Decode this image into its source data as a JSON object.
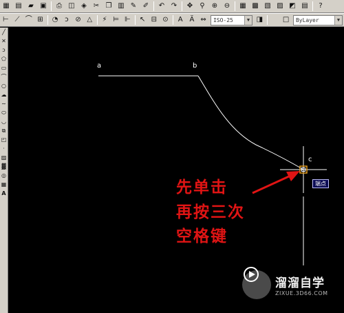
{
  "toolbar_top": {
    "icons": [
      "grid-icon",
      "new-file-icon",
      "open-folder-icon",
      "save-icon",
      "print-icon",
      "print-preview-icon",
      "publish-icon",
      "cut-icon",
      "copy-icon",
      "paste-icon",
      "match-properties-icon",
      "brush-icon",
      "undo-icon",
      "redo-icon",
      "pan-icon",
      "zoom-realtime-icon",
      "zoom-window-icon",
      "zoom-previous-icon",
      "properties-icon",
      "design-center-icon",
      "tool-palettes-icon",
      "sheet-set-icon",
      "markup-icon",
      "calculator-icon",
      "help-icon"
    ],
    "layer_combo_value": "ByLayer"
  },
  "toolbar_dim": {
    "icons": [
      "linear-dim-icon",
      "aligned-dim-icon",
      "arc-length-icon",
      "ordinate-dim-icon",
      "radius-dim-icon",
      "jogged-dim-icon",
      "diameter-dim-icon",
      "angular-dim-icon",
      "quick-dim-icon",
      "baseline-dim-icon",
      "continue-dim-icon",
      "quick-leader-icon",
      "tolerance-icon",
      "center-mark-icon",
      "dim-edit-icon",
      "dim-text-edit-icon",
      "dim-update-icon"
    ],
    "dimstyle_value": "ISO-25"
  },
  "toolbar_draw": {
    "icons": [
      "line-icon",
      "construction-line-icon",
      "polyline-icon",
      "polygon-icon",
      "rectangle-icon",
      "arc-icon",
      "circle-icon",
      "revision-cloud-icon",
      "spline-icon",
      "ellipse-icon",
      "ellipse-arc-icon",
      "insert-block-icon",
      "make-block-icon",
      "point-icon",
      "hatch-icon",
      "gradient-icon",
      "region-icon",
      "table-icon",
      "mtext-icon"
    ]
  },
  "drawing": {
    "labels": {
      "a": "a",
      "b": "b",
      "c": "c"
    },
    "snap_tooltip": "端点"
  },
  "annotation": {
    "line1": "先单击",
    "line2": "再按三次",
    "line3": "空格键",
    "color": "#e01414"
  },
  "watermark": {
    "name": "溜溜自学",
    "url": "ZIXUE.3D66.COM"
  }
}
